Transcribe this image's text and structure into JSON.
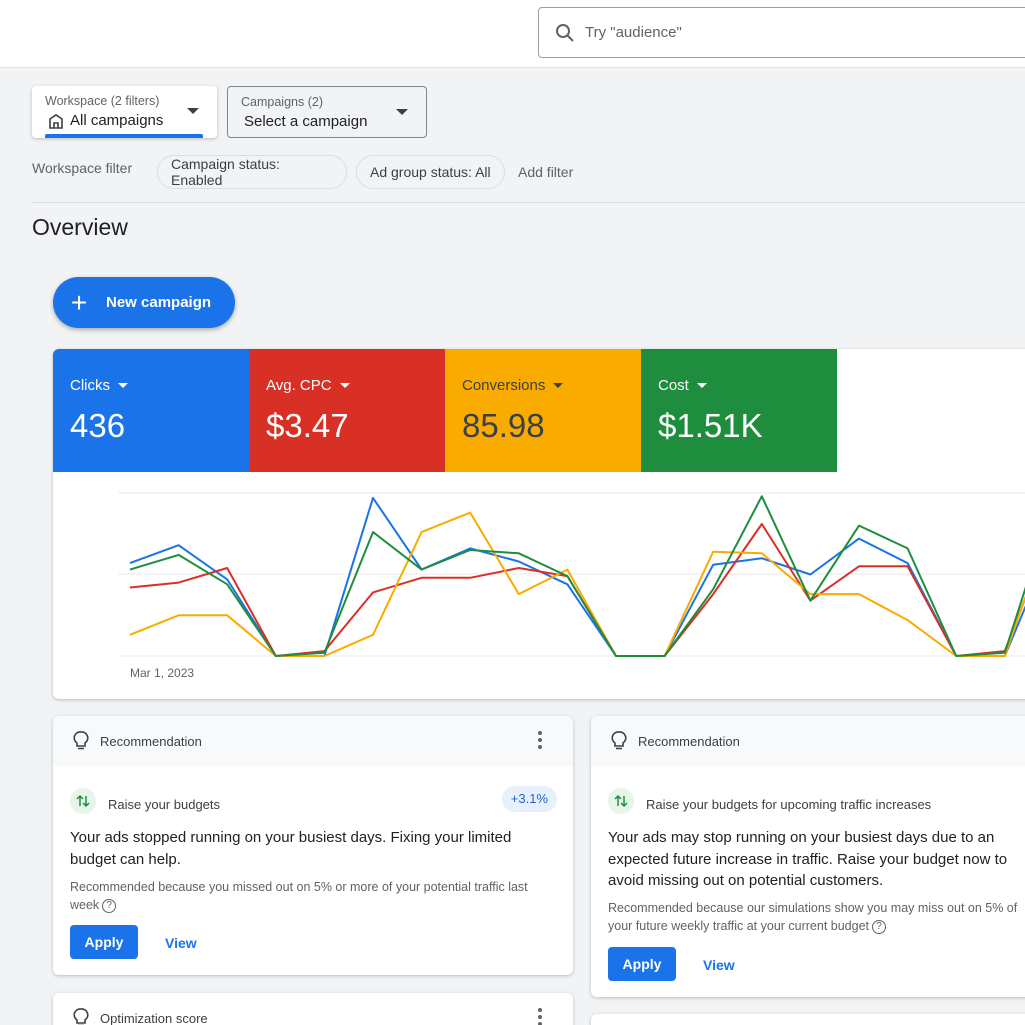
{
  "search": {
    "placeholder": "Try \"audience\"",
    "icon": "search-icon"
  },
  "filters": {
    "workspace": {
      "label": "Workspace (2 filters)",
      "value": "All campaigns",
      "icon": "building-icon"
    },
    "campaigns": {
      "label": "Campaigns (2)",
      "value": "Select a campaign"
    },
    "workspace_filter_label": "Workspace filter",
    "chips": [
      "Campaign status: Enabled",
      "Ad group status: All"
    ],
    "add_filter": "Add filter"
  },
  "overview": {
    "title": "Overview",
    "new_campaign": "New campaign"
  },
  "metrics": [
    {
      "name": "Clicks",
      "value": "436",
      "color": "#1a73e8"
    },
    {
      "name": "Avg. CPC",
      "value": "$3.47",
      "color": "#d93025"
    },
    {
      "name": "Conversions",
      "value": "85.98",
      "color": "#f9ab00"
    },
    {
      "name": "Cost",
      "value": "$1.51K",
      "color": "#1e8e3e"
    }
  ],
  "chart_data": {
    "type": "line",
    "x_first_label": "Mar 1, 2023",
    "grid": true,
    "series": [
      {
        "color": "#1a73e8",
        "values": [
          0.57,
          0.68,
          0.47,
          0.0,
          0.0,
          0.97,
          0.53,
          0.66,
          0.58,
          0.44,
          0.0,
          0.0,
          0.56,
          0.6,
          0.5,
          0.72,
          0.57,
          0.0,
          0.0,
          0.71
        ]
      },
      {
        "color": "#d93025",
        "values": [
          0.42,
          0.45,
          0.54,
          0.0,
          0.03,
          0.39,
          0.48,
          0.48,
          0.54,
          0.49,
          0.0,
          0.0,
          0.38,
          0.81,
          0.34,
          0.55,
          0.55,
          0.0,
          0.03,
          0.8
        ]
      },
      {
        "color": "#f9ab00",
        "values": [
          0.13,
          0.25,
          0.25,
          0.0,
          0.0,
          0.13,
          0.76,
          0.88,
          0.38,
          0.53,
          0.0,
          0.0,
          0.64,
          0.63,
          0.38,
          0.38,
          0.22,
          0.0,
          0.0,
          0.85
        ]
      },
      {
        "color": "#1e8e3e",
        "values": [
          0.53,
          0.62,
          0.44,
          0.0,
          0.02,
          0.76,
          0.53,
          0.65,
          0.63,
          0.49,
          0.0,
          0.0,
          0.41,
          0.98,
          0.34,
          0.8,
          0.66,
          0.0,
          0.02,
          0.95
        ]
      }
    ]
  },
  "recommendations": [
    {
      "header": "Recommendation",
      "subtitle": "Raise your budgets",
      "badge": "+3.1%",
      "title": "Your ads stopped running on your busiest days. Fixing your limited budget can help.",
      "reason": "Recommended because you missed out on 5% or more of your potential traffic last week",
      "apply": "Apply",
      "view": "View"
    },
    {
      "header": "Recommendation",
      "subtitle": "Raise your budgets for upcoming traffic increases",
      "title": "Your ads may stop running on your busiest days due to an expected future increase in traffic. Raise your budget now to avoid missing out on potential customers.",
      "reason": "Recommended because our simulations show you may miss out on 5% of your future weekly traffic at your current budget",
      "apply": "Apply",
      "view": "View"
    }
  ],
  "optimization": {
    "header": "Optimization score"
  }
}
